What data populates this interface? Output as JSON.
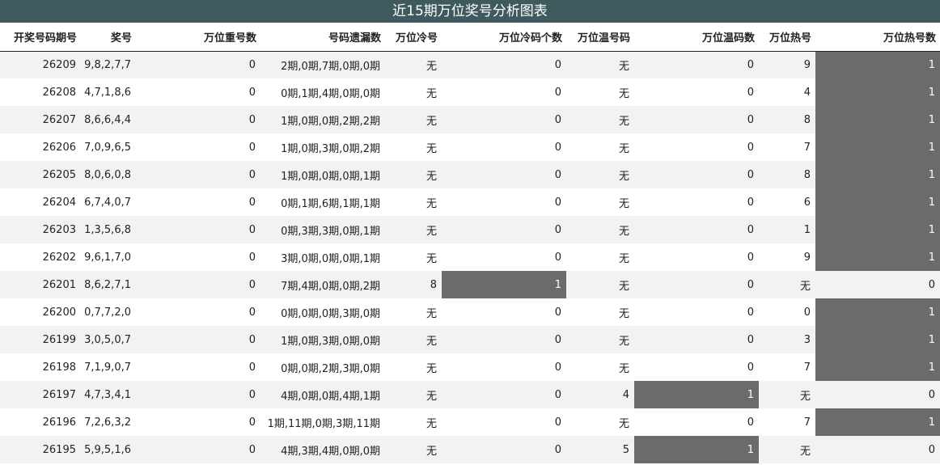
{
  "title": "近15期万位奖号分析图表",
  "columns": [
    "开奖号码期号",
    "奖号",
    "万位重号数",
    "号码遗漏数",
    "万位冷号",
    "万位冷码个数",
    "万位温号码",
    "万位温码数",
    "万位热号",
    "万位热号数"
  ],
  "rows": [
    [
      "26209",
      "9,8,2,7,7",
      "0",
      "2期,0期,7期,0期,0期",
      "无",
      "0",
      "无",
      "0",
      "9",
      "1"
    ],
    [
      "26208",
      "4,7,1,8,6",
      "0",
      "0期,1期,4期,0期,0期",
      "无",
      "0",
      "无",
      "0",
      "4",
      "1"
    ],
    [
      "26207",
      "8,6,6,4,4",
      "0",
      "1期,0期,0期,2期,2期",
      "无",
      "0",
      "无",
      "0",
      "8",
      "1"
    ],
    [
      "26206",
      "7,0,9,6,5",
      "0",
      "1期,0期,3期,0期,2期",
      "无",
      "0",
      "无",
      "0",
      "7",
      "1"
    ],
    [
      "26205",
      "8,0,6,0,8",
      "0",
      "1期,0期,0期,0期,1期",
      "无",
      "0",
      "无",
      "0",
      "8",
      "1"
    ],
    [
      "26204",
      "6,7,4,0,7",
      "0",
      "0期,1期,6期,1期,1期",
      "无",
      "0",
      "无",
      "0",
      "6",
      "1"
    ],
    [
      "26203",
      "1,3,5,6,8",
      "0",
      "0期,3期,3期,0期,1期",
      "无",
      "0",
      "无",
      "0",
      "1",
      "1"
    ],
    [
      "26202",
      "9,6,1,7,0",
      "0",
      "3期,0期,0期,0期,1期",
      "无",
      "0",
      "无",
      "0",
      "9",
      "1"
    ],
    [
      "26201",
      "8,6,2,7,1",
      "0",
      "7期,4期,0期,0期,2期",
      "8",
      "1",
      "无",
      "0",
      "无",
      "0"
    ],
    [
      "26200",
      "0,7,7,2,0",
      "0",
      "0期,0期,0期,3期,0期",
      "无",
      "0",
      "无",
      "0",
      "0",
      "1"
    ],
    [
      "26199",
      "3,0,5,0,7",
      "0",
      "1期,0期,3期,0期,0期",
      "无",
      "0",
      "无",
      "0",
      "3",
      "1"
    ],
    [
      "26198",
      "7,1,9,0,7",
      "0",
      "0期,0期,2期,3期,0期",
      "无",
      "0",
      "无",
      "0",
      "7",
      "1"
    ],
    [
      "26197",
      "4,7,3,4,1",
      "0",
      "4期,0期,0期,4期,1期",
      "无",
      "0",
      "4",
      "1",
      "无",
      "0"
    ],
    [
      "26196",
      "7,2,6,3,2",
      "0",
      "1期,11期,0期,3期,11期",
      "无",
      "0",
      "无",
      "0",
      "7",
      "1"
    ],
    [
      "26195",
      "5,9,5,1,6",
      "0",
      "4期,3期,4期,0期,0期",
      "无",
      "0",
      "5",
      "1",
      "无",
      "0"
    ]
  ],
  "highlight_color": "#6b6b6b",
  "header_bg": "#3f5a5c"
}
